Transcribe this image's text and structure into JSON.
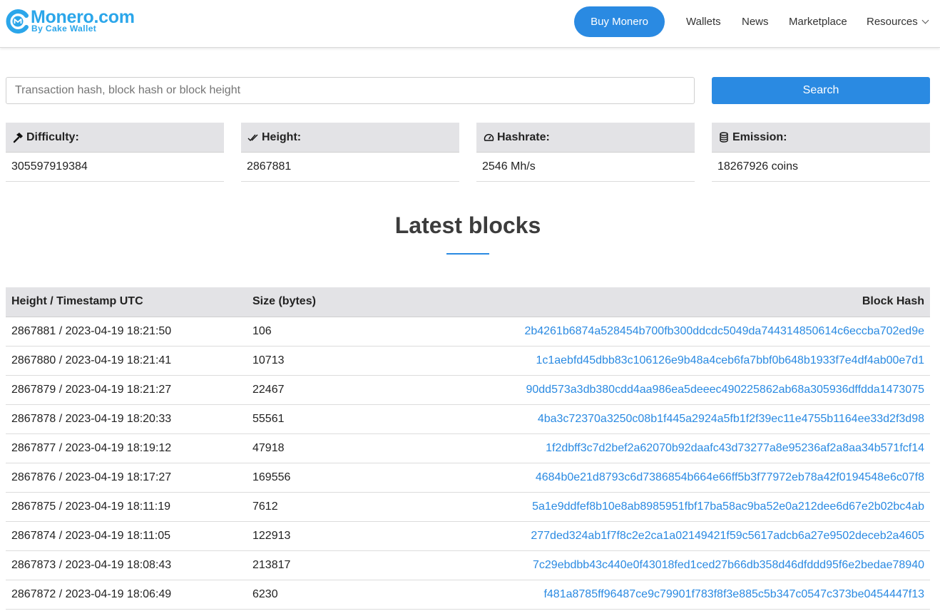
{
  "header": {
    "logo_title": "Monero.com",
    "logo_subtitle": "By Cake Wallet",
    "buy_button": "Buy Monero",
    "nav": {
      "wallets": "Wallets",
      "news": "News",
      "marketplace": "Marketplace",
      "resources": "Resources"
    }
  },
  "search": {
    "placeholder": "Transaction hash, block hash or block height",
    "button": "Search"
  },
  "stats": {
    "difficulty": {
      "label": "Difficulty:",
      "value": "305597919384"
    },
    "height": {
      "label": "Height:",
      "value": "2867881"
    },
    "hashrate": {
      "label": "Hashrate:",
      "value": "2546 Mh/s"
    },
    "emission": {
      "label": "Emission:",
      "value": "18267926 coins"
    }
  },
  "latest": {
    "title": "Latest blocks",
    "columns": {
      "height": "Height / Timestamp UTC",
      "size": "Size (bytes)",
      "hash": "Block Hash"
    },
    "rows": [
      {
        "height_ts": "2867881 / 2023-04-19 18:21:50",
        "size": "106",
        "hash": "2b4261b6874a528454b700fb300ddcdc5049da744314850614c6eccba702ed9e"
      },
      {
        "height_ts": "2867880 / 2023-04-19 18:21:41",
        "size": "10713",
        "hash": "1c1aebfd45dbb83c106126e9b48a4ceb6fa7bbf0b648b1933f7e4df4ab00e7d1"
      },
      {
        "height_ts": "2867879 / 2023-04-19 18:21:27",
        "size": "22467",
        "hash": "90dd573a3db380cdd4aa986ea5deeec490225862ab68a305936dffdda1473075"
      },
      {
        "height_ts": "2867878 / 2023-04-19 18:20:33",
        "size": "55561",
        "hash": "4ba3c72370a3250c08b1f445a2924a5fb1f2f39ec11e4755b1164ee33d2f3d98"
      },
      {
        "height_ts": "2867877 / 2023-04-19 18:19:12",
        "size": "47918",
        "hash": "1f2dbff3c7d2bef2a62070b92daafc43d73277a8e95236af2a8aa34b571fcf14"
      },
      {
        "height_ts": "2867876 / 2023-04-19 18:17:27",
        "size": "169556",
        "hash": "4684b0e21d8793c6d7386854b664e66ff5b3f77972eb78a42f0194548e6c07f8"
      },
      {
        "height_ts": "2867875 / 2023-04-19 18:11:19",
        "size": "7612",
        "hash": "5a1e9ddfef8b10e8ab8985951fbf17ba58ac9ba52e0a212dee6d67e2b02bc4ab"
      },
      {
        "height_ts": "2867874 / 2023-04-19 18:11:05",
        "size": "122913",
        "hash": "277ded324ab1f7f8c2e2ca1a02149421f59c5617adcb6a27e9502deceb2a4605"
      },
      {
        "height_ts": "2867873 / 2023-04-19 18:08:43",
        "size": "213817",
        "hash": "7c29ebdbb43c440e0f43018fed1ced27b66db358d46dfddd95f6e2bedae78940"
      },
      {
        "height_ts": "2867872 / 2023-04-19 18:06:49",
        "size": "6230",
        "hash": "f481a8785ff96487ce9c79901f783f8f3e885c5b347c0547c373be0454447f13"
      }
    ]
  },
  "icons": {
    "difficulty": "hammer-icon",
    "height": "double-check-icon",
    "hashrate": "gauge-icon",
    "emission": "coins-icon"
  },
  "colors": {
    "accent": "#2a8ae2",
    "logo": "#2ba6ea",
    "header_bg": "#e3e3e6"
  }
}
